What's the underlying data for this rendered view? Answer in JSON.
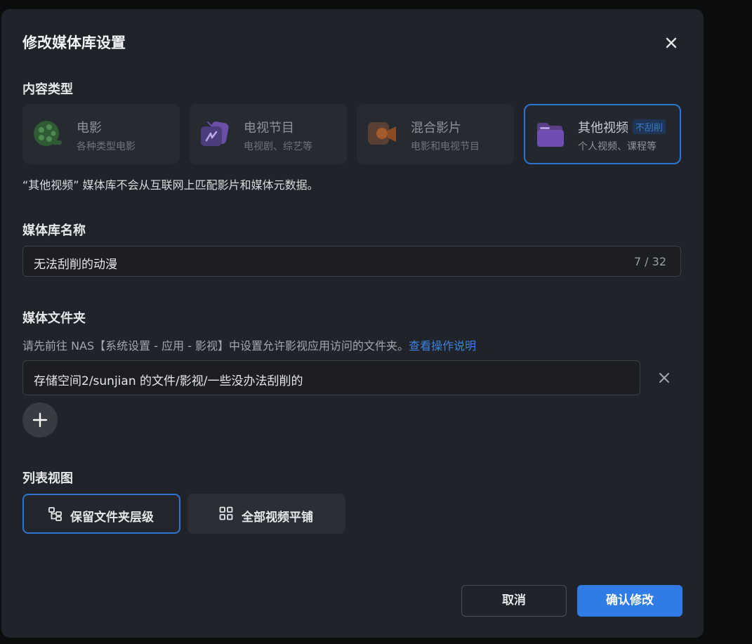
{
  "dialog": {
    "title": "修改媒体库设置"
  },
  "content_type": {
    "label": "内容类型",
    "options": [
      {
        "name": "电影",
        "desc": "各种类型电影",
        "icon": "film-reel-icon"
      },
      {
        "name": "电视节目",
        "desc": "电视剧、综艺等",
        "icon": "tv-icon"
      },
      {
        "name": "混合影片",
        "desc": "电影和电视节目",
        "icon": "video-camera-icon"
      },
      {
        "name": "其他视频",
        "desc": "个人视频、课程等",
        "icon": "folder-icon",
        "badge": "不刮削",
        "selected": true
      }
    ],
    "note": "“其他视频” 媒体库不会从互联网上匹配影片和媒体元数据。"
  },
  "library_name": {
    "label": "媒体库名称",
    "value": "无法刮削的动漫",
    "counter": "7 / 32"
  },
  "media_folder": {
    "label": "媒体文件夹",
    "hint": "请先前往 NAS【系统设置 - 应用 - 影视】中设置允许影视应用访问的文件夹。",
    "hint_link": "查看操作说明",
    "folders": [
      "存储空间2/sunjian 的文件/影视/一些没办法刮削的"
    ]
  },
  "list_view": {
    "label": "列表视图",
    "options": [
      {
        "label": "保留文件夹层级",
        "icon": "folder-tree-icon",
        "selected": true
      },
      {
        "label": "全部视频平铺",
        "icon": "grid-icon",
        "selected": false
      }
    ]
  },
  "footer": {
    "cancel_label": "取消",
    "confirm_label": "确认修改"
  },
  "colors": {
    "accent": "#2f7ce6",
    "dialog_bg": "#202329",
    "link": "#3b82e0"
  }
}
